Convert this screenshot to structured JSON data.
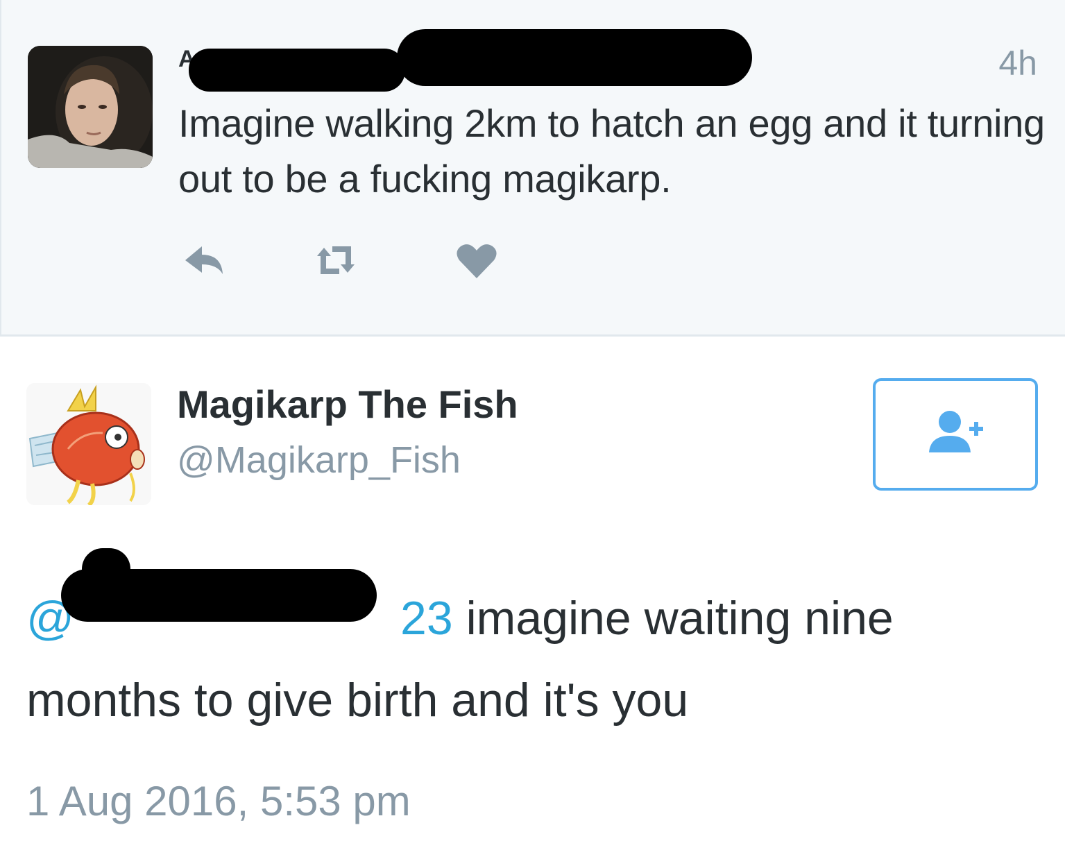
{
  "parent_tweet": {
    "author_name": "A",
    "handle": "@",
    "time": "4h",
    "text": "Imagine walking 2km to hatch an egg and it turning out to be a fucking magikarp.",
    "actions": [
      {
        "name": "reply-icon"
      },
      {
        "name": "retweet-icon"
      },
      {
        "name": "like-icon"
      }
    ]
  },
  "main_tweet": {
    "author_name": "Magikarp The Fish",
    "handle": "@Magikarp_Fish",
    "mention_prefix": "@",
    "mention_suffix": "23",
    "text": " imagine waiting nine months to give birth and it's you",
    "timestamp": "1 Aug 2016, 5:53 pm"
  },
  "colors": {
    "accent": "#55acee",
    "mention": "#2ba5da",
    "muted": "#8899a6",
    "text": "#292f33",
    "action_icon": "#8899a6"
  }
}
